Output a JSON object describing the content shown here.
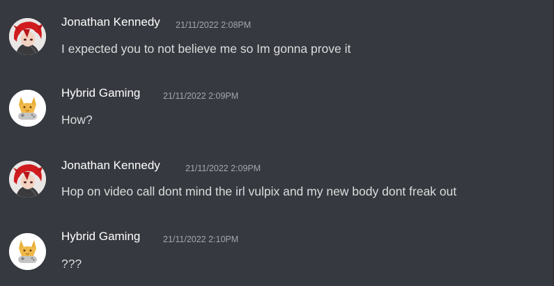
{
  "messages": [
    {
      "author": "Jonathan Kennedy",
      "timestamp": "21/11/2022 2:08PM",
      "content": "I expected you to not believe me so Im gonna prove it",
      "avatar_icon": "red-hair-anime-avatar-icon"
    },
    {
      "author": "Hybrid Gaming",
      "timestamp": "21/11/2022 2:09PM",
      "content": "How?",
      "avatar_icon": "fox-gamepad-avatar-icon"
    },
    {
      "author": "Jonathan Kennedy",
      "timestamp": "21/11/2022 2:09PM",
      "content": "Hop on video call dont mind the irl vulpix and my new body dont freak out",
      "avatar_icon": "red-hair-anime-avatar-icon"
    },
    {
      "author": "Hybrid Gaming",
      "timestamp": "21/11/2022 2:10PM",
      "content": "???",
      "avatar_icon": "fox-gamepad-avatar-icon"
    }
  ],
  "colors": {
    "background": "#36393f",
    "author": "#ffffff",
    "timestamp": "#a3a6aa",
    "content": "#dcddde"
  }
}
